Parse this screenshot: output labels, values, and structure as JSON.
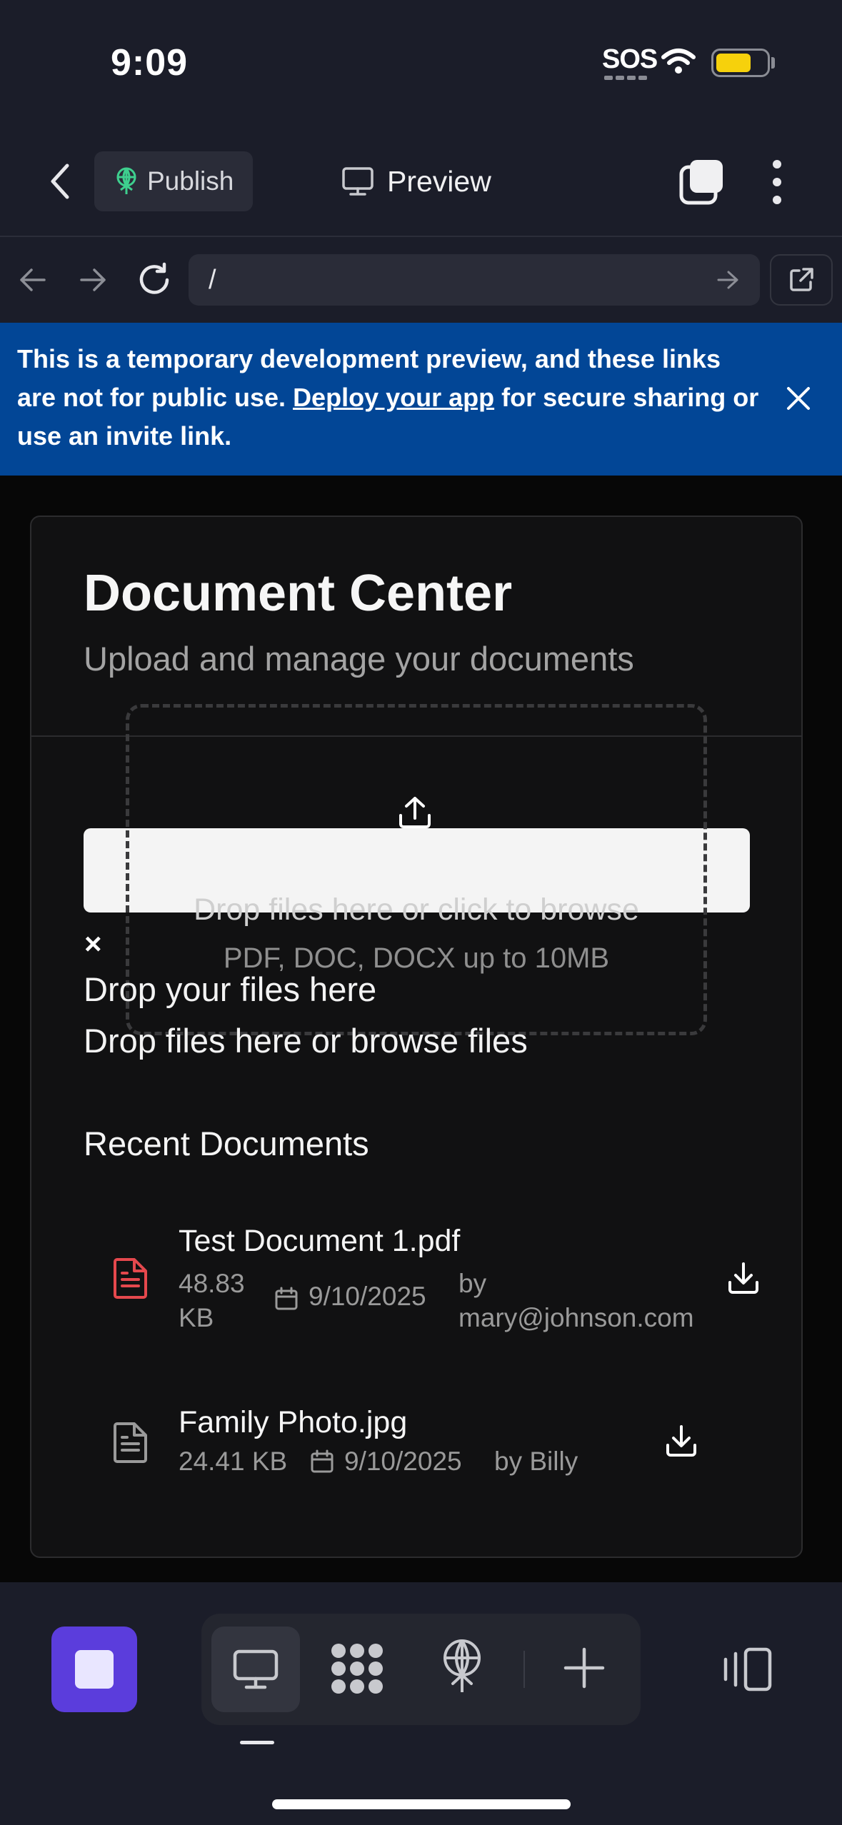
{
  "status_bar": {
    "time": "9:09",
    "sos": "SOS"
  },
  "top_bar": {
    "publish_label": "Publish",
    "preview_label": "Preview"
  },
  "browser": {
    "url": "/"
  },
  "banner": {
    "text_before": "This is a temporary development preview, and these links are not for public use. ",
    "link_text": "Deploy your app",
    "text_after": " for secure sharing or use an invite link."
  },
  "page": {
    "title": "Document Center",
    "subtitle": "Upload and manage your documents"
  },
  "upload": {
    "drop_primary": "Drop files here or click to browse",
    "drop_secondary": "PDF, DOC, DOCX up to 10MB",
    "close_glyph": "×",
    "heading": "Drop your files here",
    "description": "Drop files here or browse files"
  },
  "recent": {
    "title": "Recent Documents",
    "documents": [
      {
        "name": "Test Document 1.pdf",
        "size": "48.83 KB",
        "date": "9/10/2025",
        "by": "by mary@johnson.com",
        "icon": "file-text-icon",
        "icon_color": "#e5484d"
      },
      {
        "name": "Family Photo.jpg",
        "size": "24.41 KB",
        "date": "9/10/2025",
        "by": "by Billy",
        "icon": "file-text-icon",
        "icon_color": "#9a9a9a"
      }
    ]
  },
  "colors": {
    "banner": "#024696",
    "accent": "#5b3ddc",
    "background": "#1b1d29",
    "card": "#111112"
  }
}
